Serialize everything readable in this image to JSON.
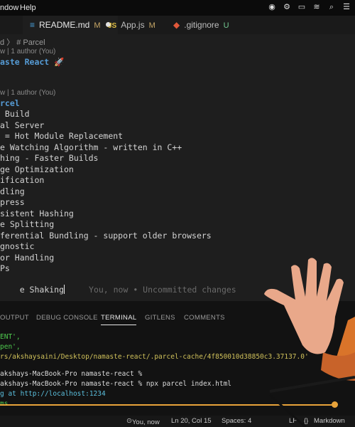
{
  "menubar": {
    "window_label": "ndow",
    "help_label": "Help"
  },
  "tabs": [
    {
      "label": "README.md",
      "badge": "M"
    },
    {
      "label": "App.js",
      "badge": "M"
    },
    {
      "label": ".gitignore",
      "badge": "U"
    }
  ],
  "breadcrumb": "d 〉 # Parcel",
  "editor": {
    "blame1": "w | 1 author (You)",
    "title": "aste React 🚀",
    "blame2": "w | 1 author (You)",
    "heading": "rcel",
    "lines": [
      " Build",
      "al Server",
      " = Hot Module Replacement",
      "e Watching Algorithm - written in C++",
      "hing - Faster Builds",
      "ge Optimization",
      "ification",
      "dling",
      "press",
      "sistent Hashing",
      "e Splitting",
      "ferential Bundling - support older browsers",
      "gnostic",
      "or Handling",
      "Ps",
      "e Shaking"
    ],
    "ghost_text": "You, now • Uncommitted changes"
  },
  "panel": {
    "tabs": [
      "OUTPUT",
      "DEBUG CONSOLE",
      "TERMINAL",
      "GITLENS",
      "COMMENTS"
    ],
    "terminal": [
      "ENT',",
      "pen',",
      "rs/akshaysaini/Desktop/namaste-react/.parcel-cache/4f850010d38850c3.37137.0'",
      "akshays-MacBook-Pro namaste-react %",
      "akshays-MacBook-Pro namaste-react % npx parcel index.html",
      "g at http://localhost:1234",
      "ms"
    ]
  },
  "status": {
    "git": "You, now",
    "position": "Ln 20, Col 15",
    "spaces": "Spaces: 4",
    "eol": "LF",
    "language": "Markdown"
  },
  "colors": {
    "accent": "#e8a33a",
    "heading": "#569cd6",
    "terminal_green": "#4ec94e"
  }
}
